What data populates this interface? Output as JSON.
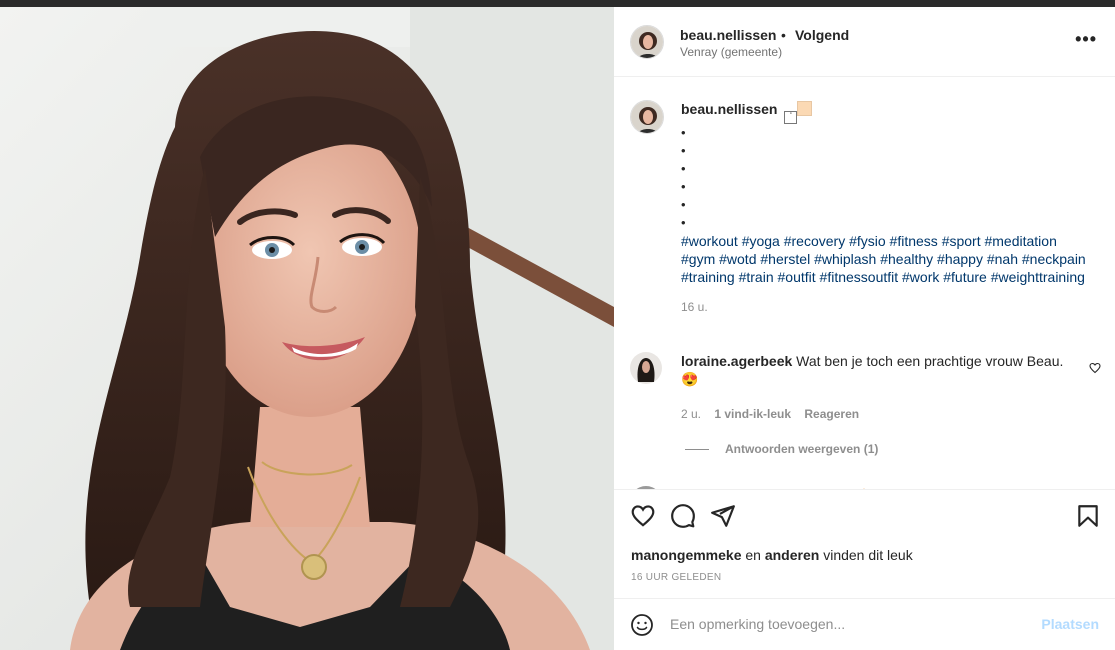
{
  "post": {
    "author": "beau.nellissen",
    "separator": "•",
    "follow_label": "Volgend",
    "location": "Venray (gemeente)",
    "more_label": "•••"
  },
  "caption": {
    "author": "beau.nellissen",
    "hashtags": "#workout #yoga #recovery #fysio #fitness #sport #meditation #gym #wotd #herstel #whiplash #healthy #happy #nah #neckpain #training #train #outfit #fitnessoutfit #work #future #weighttraining",
    "time": "16 u."
  },
  "comment": {
    "author": "loraine.agerbeek",
    "text": "Wat ben je toch een prachtige vrouw Beau. 😍",
    "time": "2 u.",
    "likes": "1 vind-ik-leuk",
    "reply": "Reageren",
    "view_replies": "Antwoorden weergeven (1)"
  },
  "likes": {
    "user": "manongemmeke",
    "connector": "en",
    "others": "anderen",
    "suffix": "vinden dit leuk"
  },
  "timestamp": "16 UUR GELEDEN",
  "comment_box": {
    "placeholder": "Een opmerking toevoegen...",
    "post_label": "Plaatsen"
  },
  "icons": [
    "like-icon",
    "comment-icon",
    "share-icon",
    "save-icon",
    "emoji-icon",
    "heart-small-icon"
  ],
  "colors": {
    "hashtag": "#00376b",
    "post_button_disabled": "#b3dbff",
    "text": "#262626",
    "secondary_text": "#8e8e8e"
  }
}
